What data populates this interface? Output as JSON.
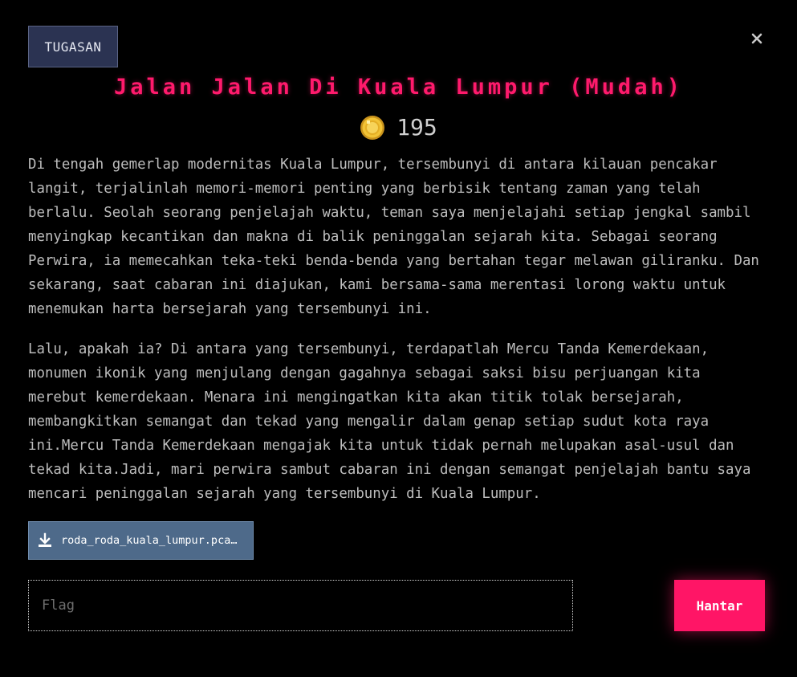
{
  "challenge": {
    "category": "TUGASAN",
    "title": "Jalan Jalan Di Kuala Lumpur (Mudah)",
    "points": "195",
    "paragraphs": [
      "Di tengah gemerlap modernitas Kuala Lumpur, tersembunyi di antara kilauan pencakar langit, terjalinlah memori-memori penting yang berbisik tentang zaman yang telah berlalu. Seolah seorang penjelajah waktu, teman saya menjelajahi setiap jengkal sambil menyingkap kecantikan dan makna di balik peninggalan sejarah kita. Sebagai seorang Perwira, ia memecahkan teka-teki benda-benda yang bertahan tegar melawan giliranku. Dan sekarang, saat cabaran ini diajukan, kami bersama-sama merentasi lorong waktu untuk menemukan harta bersejarah yang tersembunyi ini.",
      "Lalu, apakah ia? Di antara yang tersembunyi, terdapatlah Mercu Tanda Kemerdekaan, monumen ikonik yang menjulang dengan gagahnya sebagai saksi bisu perjuangan kita merebut kemerdekaan. Menara ini mengingatkan kita akan titik tolak bersejarah, membangkitkan semangat dan tekad yang mengalir dalam genap setiap sudut kota raya ini.Mercu Tanda Kemerdekaan mengajak kita untuk tidak pernah melupakan asal-usul dan tekad kita.Jadi, mari perwira sambut cabaran ini dengan semangat penjelajah bantu saya mencari peninggalan sejarah yang tersembunyi di Kuala Lumpur."
    ],
    "file_name": "roda_roda_kuala_lumpur.pcapng",
    "file_name_display": "roda_roda_kuala_lumpur.pca…"
  },
  "form": {
    "flag_placeholder": "Flag",
    "flag_value": "",
    "submit_label": "Hantar"
  },
  "icons": {
    "close": "close-icon",
    "coin": "coin-icon",
    "download": "download-icon"
  },
  "colors": {
    "background": "#000000",
    "accent": "#ff1566",
    "title": "#ff1a6c",
    "tag_bg": "#2b3352",
    "file_btn_bg": "#4e6a8a",
    "coin": "#f2c335"
  }
}
